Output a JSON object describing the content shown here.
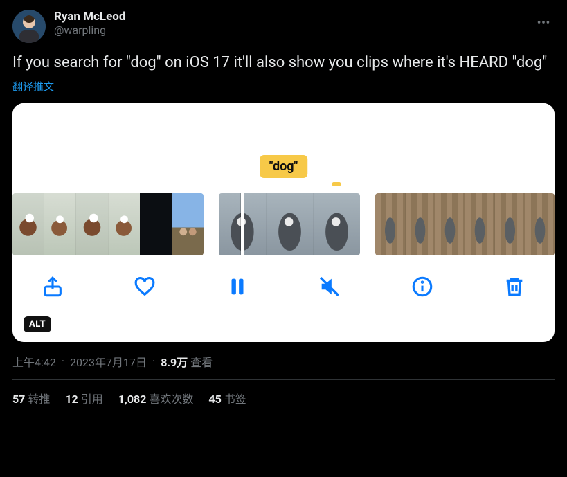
{
  "author": {
    "display_name": "Ryan McLeod",
    "handle": "@warpling"
  },
  "tweet_text": "If you search for \"dog\" on iOS 17 it'll also show you clips where it's HEARD \"dog\"",
  "translate_label": "翻译推文",
  "media": {
    "keyword_label": "\"dog\"",
    "alt_badge": "ALT",
    "toolbar": {
      "share": "share",
      "like": "like",
      "pause": "pause",
      "mute": "mute",
      "info": "info",
      "trash": "trash"
    }
  },
  "meta": {
    "time": "上午4:42",
    "date": "2023年7月17日",
    "views_number": "8.9万",
    "views_label": "查看"
  },
  "stats": {
    "retweets_n": "57",
    "retweets_label": "转推",
    "quotes_n": "12",
    "quotes_label": "引用",
    "likes_n": "1,082",
    "likes_label": "喜欢次数",
    "bookmarks_n": "45",
    "bookmarks_label": "书签"
  }
}
